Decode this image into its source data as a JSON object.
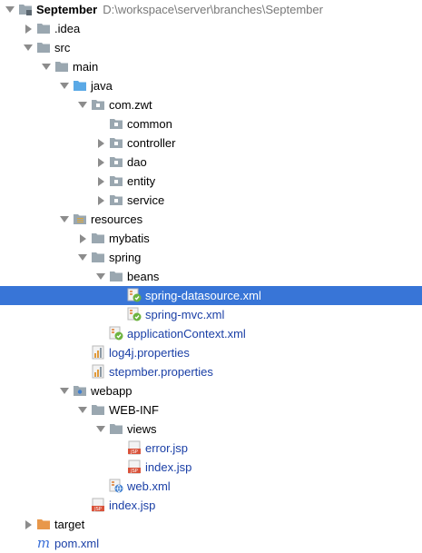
{
  "project": {
    "name": "September",
    "path": "D:\\workspace\\server\\branches\\September"
  },
  "tree": [
    {
      "label": "September",
      "kind": "root-folder",
      "expanded": true,
      "depth": 0,
      "bold": true,
      "path": "D:\\workspace\\server\\branches\\September"
    },
    {
      "label": ".idea",
      "kind": "folder",
      "expanded": false,
      "depth": 1
    },
    {
      "label": "src",
      "kind": "folder",
      "expanded": true,
      "depth": 1
    },
    {
      "label": "main",
      "kind": "folder",
      "expanded": true,
      "depth": 2
    },
    {
      "label": "java",
      "kind": "source-folder",
      "expanded": true,
      "depth": 3
    },
    {
      "label": "com.zwt",
      "kind": "package",
      "expanded": true,
      "depth": 4
    },
    {
      "label": "common",
      "kind": "package",
      "expanded": null,
      "depth": 5
    },
    {
      "label": "controller",
      "kind": "package",
      "expanded": false,
      "depth": 5
    },
    {
      "label": "dao",
      "kind": "package",
      "expanded": false,
      "depth": 5
    },
    {
      "label": "entity",
      "kind": "package",
      "expanded": false,
      "depth": 5
    },
    {
      "label": "service",
      "kind": "package",
      "expanded": false,
      "depth": 5
    },
    {
      "label": "resources",
      "kind": "resources-folder",
      "expanded": true,
      "depth": 3
    },
    {
      "label": "mybatis",
      "kind": "folder",
      "expanded": false,
      "depth": 4
    },
    {
      "label": "spring",
      "kind": "folder",
      "expanded": true,
      "depth": 4
    },
    {
      "label": "beans",
      "kind": "folder",
      "expanded": true,
      "depth": 5
    },
    {
      "label": "spring-datasource.xml",
      "kind": "spring-xml",
      "expanded": null,
      "depth": 6,
      "selected": true,
      "blue": true
    },
    {
      "label": "spring-mvc.xml",
      "kind": "spring-xml",
      "expanded": null,
      "depth": 6,
      "blue": true
    },
    {
      "label": "applicationContext.xml",
      "kind": "spring-xml",
      "expanded": null,
      "depth": 5,
      "blue": true
    },
    {
      "label": "log4j.properties",
      "kind": "properties",
      "expanded": null,
      "depth": 4,
      "blue": true
    },
    {
      "label": "stepmber.properties",
      "kind": "properties",
      "expanded": null,
      "depth": 4,
      "blue": true
    },
    {
      "label": "webapp",
      "kind": "web-folder",
      "expanded": true,
      "depth": 3
    },
    {
      "label": "WEB-INF",
      "kind": "folder",
      "expanded": true,
      "depth": 4
    },
    {
      "label": "views",
      "kind": "folder",
      "expanded": true,
      "depth": 5
    },
    {
      "label": "error.jsp",
      "kind": "jsp",
      "expanded": null,
      "depth": 6,
      "blue": true
    },
    {
      "label": "index.jsp",
      "kind": "jsp",
      "expanded": null,
      "depth": 6,
      "blue": true
    },
    {
      "label": "web.xml",
      "kind": "web-xml",
      "expanded": null,
      "depth": 5,
      "blue": true
    },
    {
      "label": "index.jsp",
      "kind": "jsp",
      "expanded": null,
      "depth": 4,
      "blue": true
    },
    {
      "label": "target",
      "kind": "excluded-folder",
      "expanded": false,
      "depth": 1
    },
    {
      "label": "pom.xml",
      "kind": "maven",
      "expanded": null,
      "depth": 1,
      "blue": true
    }
  ],
  "colors": {
    "selection": "#3875d7",
    "folder": "#9aa7b0",
    "source_folder": "#5aa9e6",
    "excluded_folder": "#e8974a",
    "file_text": "#1a3fa6",
    "maven": "#3b6fd8"
  }
}
